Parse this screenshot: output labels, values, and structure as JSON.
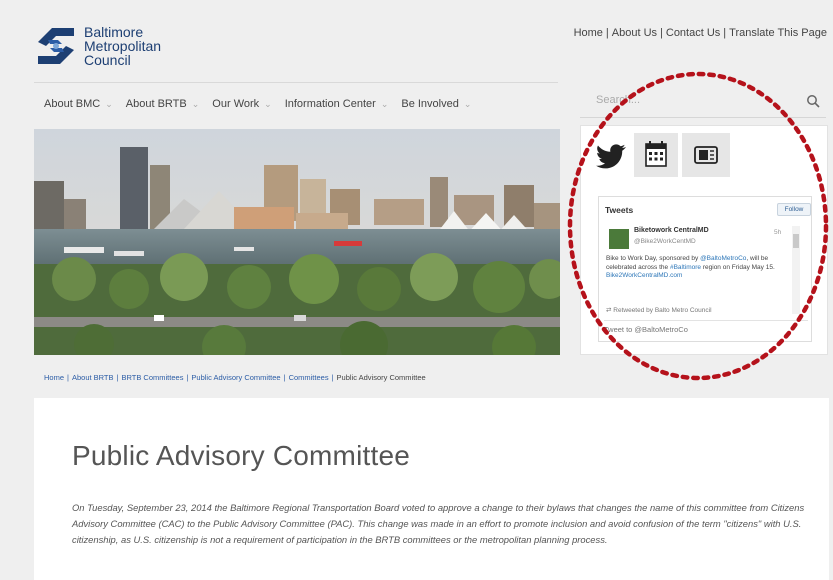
{
  "header": {
    "logo_lines": [
      "Baltimore",
      "Metropolitan",
      "Council"
    ],
    "top_links": [
      "Home",
      "About Us",
      "Contact Us",
      "Translate This Page"
    ]
  },
  "nav": {
    "items": [
      {
        "label": "About BMC",
        "has_dropdown": true
      },
      {
        "label": "About BRTB",
        "has_dropdown": true
      },
      {
        "label": "Our Work",
        "has_dropdown": true
      },
      {
        "label": "Information Center",
        "has_dropdown": true
      },
      {
        "label": "Be Involved",
        "has_dropdown": true
      }
    ]
  },
  "search": {
    "placeholder": "Search...",
    "icon": "search-icon"
  },
  "breadcrumb": {
    "items": [
      "Home",
      "About BRTB",
      "BRTB Committees",
      "Public Advisory Committee",
      "Committees"
    ],
    "current": "Public Advisory Committee"
  },
  "main": {
    "title": "Public Advisory Committee",
    "body": "On Tuesday, September 23, 2014 the Baltimore Regional Transportation Board voted to approve a change to their bylaws that changes the name of this committee from Citizens Advisory Committee (CAC) to the Public Advisory Committee (PAC). This change was made in an effort to promote inclusion and avoid confusion of the term \"citizens\" with U.S. citizenship, as U.S. citizenship is not a requirement of participation in the BRTB committees or the metropolitan planning process."
  },
  "widget": {
    "tabs": [
      {
        "icon": "twitter-icon",
        "active": true
      },
      {
        "icon": "calendar-icon",
        "active": false
      },
      {
        "icon": "news-icon",
        "active": false
      }
    ],
    "tweets_title": "Tweets",
    "follow_label": "Follow",
    "tweet": {
      "name": "Biketowork CentralMD",
      "handle": "@Bike2WorkCentMD",
      "time": "5h",
      "text_1": "Bike to Work Day, sponsored by",
      "mention": "@BaltoMetroCo",
      "text_2": ", will be celebrated across the",
      "hashtag": "#Baltimore",
      "text_3": " region on Friday May 15.",
      "link": "Bike2WorkCentralMD.com",
      "retweet": "Retweeted by Balto Metro Council"
    },
    "tweet_input_placeholder": "Tweet to @BaltoMetroCo"
  },
  "colors": {
    "accent_blue": "#2c5da6",
    "logo_blue": "#1d3f73",
    "annotation_red": "#b5121b",
    "background": "#efefef"
  }
}
